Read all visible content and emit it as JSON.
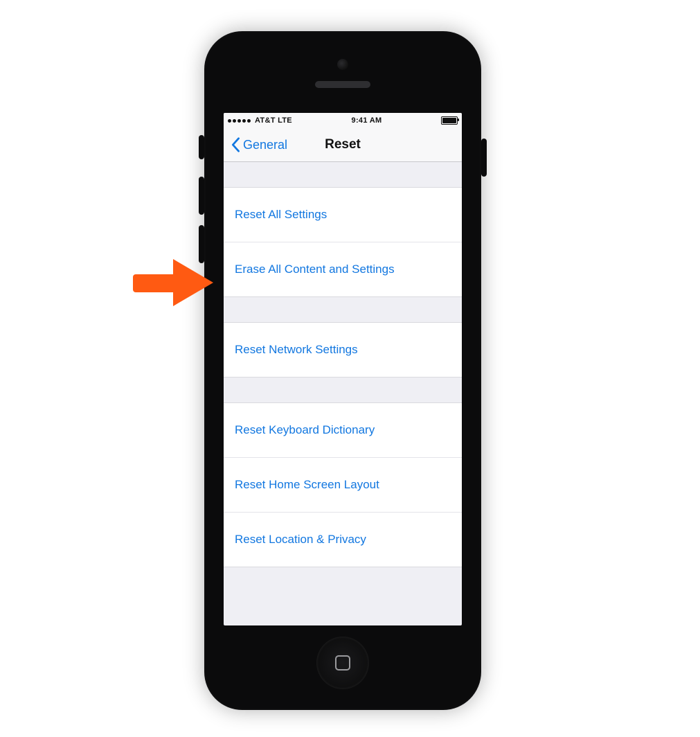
{
  "status_bar": {
    "carrier": "AT&T  LTE",
    "time": "9:41 AM"
  },
  "nav": {
    "back_label": "General",
    "title": "Reset"
  },
  "groups": {
    "g1": {
      "r0": "Reset All Settings",
      "r1": "Erase All Content and Settings"
    },
    "g2": {
      "r0": "Reset Network Settings"
    },
    "g3": {
      "r0": "Reset Keyboard Dictionary",
      "r1": "Reset Home Screen Layout",
      "r2": "Reset Location & Privacy"
    }
  },
  "annotation": {
    "arrow_color": "#ff5a12"
  }
}
